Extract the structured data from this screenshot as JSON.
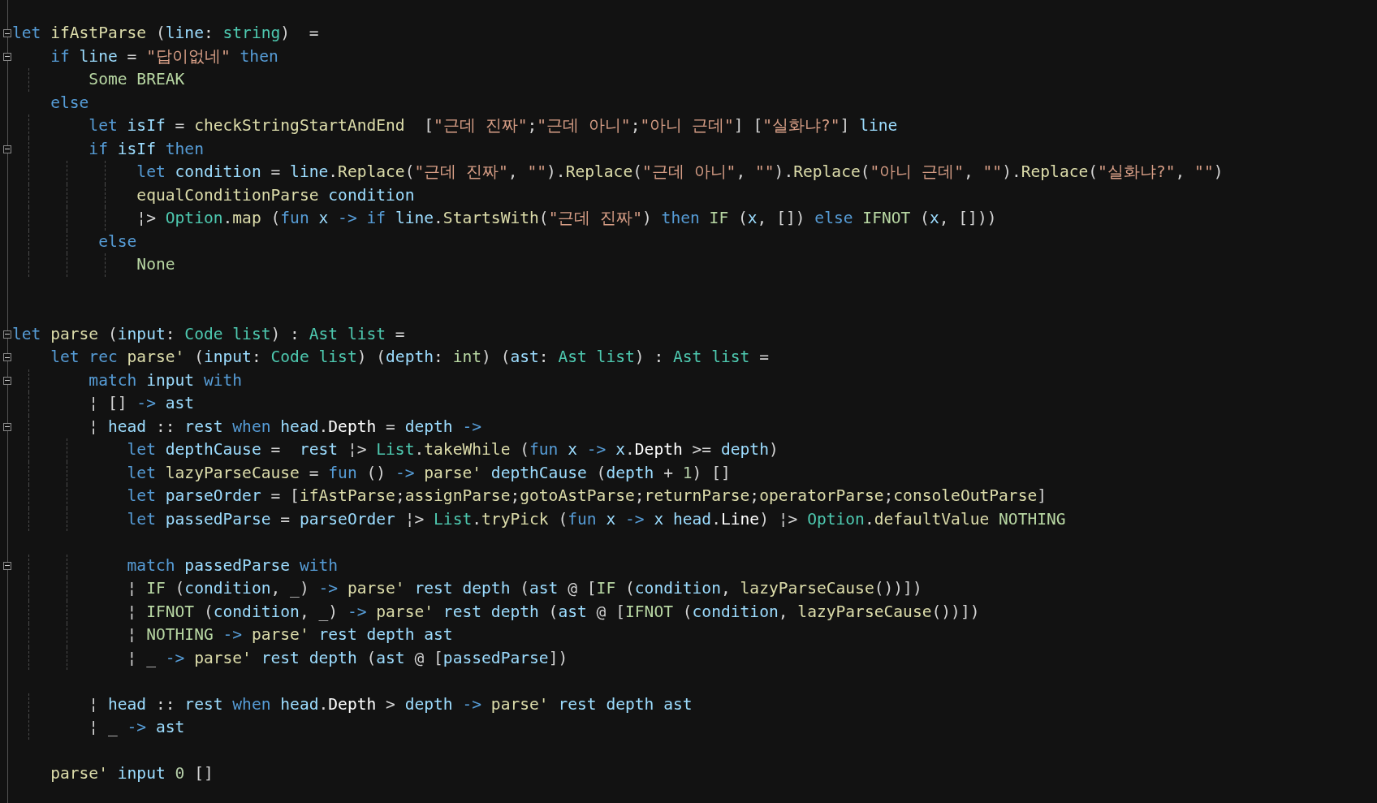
{
  "editor": {
    "lines": [
      {
        "kind": "code",
        "collapsible": true,
        "tokens": [
          {
            "kind": "keyword",
            "text": "let "
          },
          {
            "kind": "function",
            "text": "ifAstParse"
          },
          {
            "kind": "plain",
            "text": " ("
          },
          {
            "kind": "variable",
            "text": "line"
          },
          {
            "kind": "plain",
            "text": ": "
          },
          {
            "kind": "type",
            "text": "string"
          },
          {
            "kind": "plain",
            "text": ")  ="
          }
        ]
      },
      {
        "kind": "code",
        "collapsible": true,
        "tokens": [
          {
            "kind": "keyword",
            "text": "    if "
          },
          {
            "kind": "variable",
            "text": "line"
          },
          {
            "kind": "plain",
            "text": " = "
          },
          {
            "kind": "string",
            "text": "\"답이없네\""
          },
          {
            "kind": "keyword",
            "text": " then"
          }
        ]
      },
      {
        "kind": "code",
        "collapsible": false,
        "tokens": [
          {
            "kind": "case",
            "text": "        Some BREAK"
          }
        ]
      },
      {
        "kind": "code",
        "collapsible": false,
        "tokens": [
          {
            "kind": "keyword",
            "text": "    else"
          }
        ]
      },
      {
        "kind": "code",
        "collapsible": false,
        "tokens": [
          {
            "kind": "keyword",
            "text": "        let "
          },
          {
            "kind": "variable",
            "text": "isIf"
          },
          {
            "kind": "plain",
            "text": " = "
          },
          {
            "kind": "function",
            "text": "checkStringStartAndEnd"
          },
          {
            "kind": "plain",
            "text": "  ["
          },
          {
            "kind": "string",
            "text": "\"근데 진짜\""
          },
          {
            "kind": "plain",
            "text": ";"
          },
          {
            "kind": "string",
            "text": "\"근데 아니\""
          },
          {
            "kind": "plain",
            "text": ";"
          },
          {
            "kind": "string",
            "text": "\"아니 근데\""
          },
          {
            "kind": "plain",
            "text": "] ["
          },
          {
            "kind": "string",
            "text": "\"실화냐?\""
          },
          {
            "kind": "plain",
            "text": "] "
          },
          {
            "kind": "variable",
            "text": "line"
          }
        ]
      },
      {
        "kind": "code",
        "collapsible": true,
        "tokens": [
          {
            "kind": "keyword",
            "text": "        if "
          },
          {
            "kind": "variable",
            "text": "isIf"
          },
          {
            "kind": "keyword",
            "text": " then"
          }
        ]
      },
      {
        "kind": "code",
        "collapsible": false,
        "tokens": [
          {
            "kind": "keyword",
            "text": "             let "
          },
          {
            "kind": "variable",
            "text": "condition"
          },
          {
            "kind": "plain",
            "text": " = "
          },
          {
            "kind": "variable",
            "text": "line"
          },
          {
            "kind": "plain",
            "text": "."
          },
          {
            "kind": "function",
            "text": "Replace"
          },
          {
            "kind": "plain",
            "text": "("
          },
          {
            "kind": "string",
            "text": "\"근데 진짜\""
          },
          {
            "kind": "plain",
            "text": ", "
          },
          {
            "kind": "string",
            "text": "\"\""
          },
          {
            "kind": "plain",
            "text": ")."
          },
          {
            "kind": "function",
            "text": "Replace"
          },
          {
            "kind": "plain",
            "text": "("
          },
          {
            "kind": "string",
            "text": "\"근데 아니\""
          },
          {
            "kind": "plain",
            "text": ", "
          },
          {
            "kind": "string",
            "text": "\"\""
          },
          {
            "kind": "plain",
            "text": ")."
          },
          {
            "kind": "function",
            "text": "Replace"
          },
          {
            "kind": "plain",
            "text": "("
          },
          {
            "kind": "string",
            "text": "\"아니 근데\""
          },
          {
            "kind": "plain",
            "text": ", "
          },
          {
            "kind": "string",
            "text": "\"\""
          },
          {
            "kind": "plain",
            "text": ")."
          },
          {
            "kind": "function",
            "text": "Replace"
          },
          {
            "kind": "plain",
            "text": "("
          },
          {
            "kind": "string",
            "text": "\"실화냐?\""
          },
          {
            "kind": "plain",
            "text": ", "
          },
          {
            "kind": "string",
            "text": "\"\""
          },
          {
            "kind": "plain",
            "text": ")"
          }
        ]
      },
      {
        "kind": "code",
        "collapsible": false,
        "tokens": [
          {
            "kind": "function",
            "text": "             equalConditionParse "
          },
          {
            "kind": "variable",
            "text": "condition"
          }
        ]
      },
      {
        "kind": "code",
        "collapsible": false,
        "tokens": [
          {
            "kind": "plain",
            "text": "             ¦> "
          },
          {
            "kind": "type",
            "text": "Option"
          },
          {
            "kind": "plain",
            "text": "."
          },
          {
            "kind": "function",
            "text": "map"
          },
          {
            "kind": "plain",
            "text": " ("
          },
          {
            "kind": "keyword",
            "text": "fun "
          },
          {
            "kind": "variable",
            "text": "x"
          },
          {
            "kind": "keyword",
            "text": " -> if "
          },
          {
            "kind": "variable",
            "text": "line"
          },
          {
            "kind": "plain",
            "text": "."
          },
          {
            "kind": "function",
            "text": "StartsWith"
          },
          {
            "kind": "plain",
            "text": "("
          },
          {
            "kind": "string",
            "text": "\"근데 진짜\""
          },
          {
            "kind": "plain",
            "text": ") "
          },
          {
            "kind": "keyword",
            "text": "then "
          },
          {
            "kind": "case",
            "text": "IF"
          },
          {
            "kind": "plain",
            "text": " ("
          },
          {
            "kind": "variable",
            "text": "x"
          },
          {
            "kind": "plain",
            "text": ", []) "
          },
          {
            "kind": "keyword",
            "text": "else "
          },
          {
            "kind": "case",
            "text": "IFNOT"
          },
          {
            "kind": "plain",
            "text": " ("
          },
          {
            "kind": "variable",
            "text": "x"
          },
          {
            "kind": "plain",
            "text": ", []))"
          }
        ]
      },
      {
        "kind": "code",
        "collapsible": false,
        "tokens": [
          {
            "kind": "keyword",
            "text": "         else"
          }
        ]
      },
      {
        "kind": "code",
        "collapsible": false,
        "tokens": [
          {
            "kind": "case",
            "text": "             None"
          }
        ]
      },
      {
        "kind": "blank"
      },
      {
        "kind": "blank"
      },
      {
        "kind": "code",
        "collapsible": true,
        "tokens": [
          {
            "kind": "keyword",
            "text": "let "
          },
          {
            "kind": "function",
            "text": "parse"
          },
          {
            "kind": "plain",
            "text": " ("
          },
          {
            "kind": "variable",
            "text": "input"
          },
          {
            "kind": "plain",
            "text": ": "
          },
          {
            "kind": "type",
            "text": "Code list"
          },
          {
            "kind": "plain",
            "text": ") : "
          },
          {
            "kind": "type",
            "text": "Ast list"
          },
          {
            "kind": "plain",
            "text": " ="
          }
        ]
      },
      {
        "kind": "code",
        "collapsible": true,
        "tokens": [
          {
            "kind": "keyword",
            "text": "    let rec "
          },
          {
            "kind": "function",
            "text": "parse'"
          },
          {
            "kind": "plain",
            "text": " ("
          },
          {
            "kind": "variable",
            "text": "input"
          },
          {
            "kind": "plain",
            "text": ": "
          },
          {
            "kind": "type",
            "text": "Code list"
          },
          {
            "kind": "plain",
            "text": ") ("
          },
          {
            "kind": "variable",
            "text": "depth"
          },
          {
            "kind": "plain",
            "text": ": "
          },
          {
            "kind": "case",
            "text": "int"
          },
          {
            "kind": "plain",
            "text": ") ("
          },
          {
            "kind": "variable",
            "text": "ast"
          },
          {
            "kind": "plain",
            "text": ": "
          },
          {
            "kind": "type",
            "text": "Ast list"
          },
          {
            "kind": "plain",
            "text": ") : "
          },
          {
            "kind": "type",
            "text": "Ast list"
          },
          {
            "kind": "plain",
            "text": " ="
          }
        ]
      },
      {
        "kind": "code",
        "collapsible": true,
        "tokens": [
          {
            "kind": "keyword",
            "text": "        match "
          },
          {
            "kind": "variable",
            "text": "input"
          },
          {
            "kind": "keyword",
            "text": " with"
          }
        ]
      },
      {
        "kind": "code",
        "collapsible": false,
        "tokens": [
          {
            "kind": "plain",
            "text": "        ¦ [] "
          },
          {
            "kind": "keyword",
            "text": "->"
          },
          {
            "kind": "variable",
            "text": " ast"
          }
        ]
      },
      {
        "kind": "code",
        "collapsible": true,
        "tokens": [
          {
            "kind": "plain",
            "text": "        ¦ "
          },
          {
            "kind": "variable",
            "text": "head"
          },
          {
            "kind": "plain",
            "text": " :: "
          },
          {
            "kind": "variable",
            "text": "rest"
          },
          {
            "kind": "keyword",
            "text": " when "
          },
          {
            "kind": "variable",
            "text": "head"
          },
          {
            "kind": "plain",
            "text": "."
          },
          {
            "kind": "member",
            "text": "Depth"
          },
          {
            "kind": "plain",
            "text": " = "
          },
          {
            "kind": "variable",
            "text": "depth"
          },
          {
            "kind": "keyword",
            "text": " ->"
          }
        ]
      },
      {
        "kind": "code",
        "collapsible": false,
        "tokens": [
          {
            "kind": "keyword",
            "text": "            let "
          },
          {
            "kind": "variable",
            "text": "depthCause"
          },
          {
            "kind": "plain",
            "text": " =  "
          },
          {
            "kind": "variable",
            "text": "rest"
          },
          {
            "kind": "plain",
            "text": " ¦> "
          },
          {
            "kind": "type",
            "text": "List"
          },
          {
            "kind": "plain",
            "text": "."
          },
          {
            "kind": "function",
            "text": "takeWhile"
          },
          {
            "kind": "plain",
            "text": " ("
          },
          {
            "kind": "keyword",
            "text": "fun "
          },
          {
            "kind": "variable",
            "text": "x"
          },
          {
            "kind": "keyword",
            "text": " -> "
          },
          {
            "kind": "variable",
            "text": "x"
          },
          {
            "kind": "plain",
            "text": "."
          },
          {
            "kind": "member",
            "text": "Depth"
          },
          {
            "kind": "plain",
            "text": " >= "
          },
          {
            "kind": "variable",
            "text": "depth"
          },
          {
            "kind": "plain",
            "text": ")"
          }
        ]
      },
      {
        "kind": "code",
        "collapsible": false,
        "tokens": [
          {
            "kind": "keyword",
            "text": "            let "
          },
          {
            "kind": "function",
            "text": "lazyParseCause"
          },
          {
            "kind": "plain",
            "text": " = "
          },
          {
            "kind": "keyword",
            "text": "fun "
          },
          {
            "kind": "plain",
            "text": "() "
          },
          {
            "kind": "keyword",
            "text": "-> "
          },
          {
            "kind": "function",
            "text": "parse'"
          },
          {
            "kind": "variable",
            "text": " depthCause"
          },
          {
            "kind": "plain",
            "text": " ("
          },
          {
            "kind": "variable",
            "text": "depth"
          },
          {
            "kind": "plain",
            "text": " + "
          },
          {
            "kind": "number",
            "text": "1"
          },
          {
            "kind": "plain",
            "text": ") []"
          }
        ]
      },
      {
        "kind": "code",
        "collapsible": false,
        "tokens": [
          {
            "kind": "keyword",
            "text": "            let "
          },
          {
            "kind": "variable",
            "text": "parseOrder"
          },
          {
            "kind": "plain",
            "text": " = ["
          },
          {
            "kind": "function",
            "text": "ifAstParse"
          },
          {
            "kind": "plain",
            "text": ";"
          },
          {
            "kind": "function",
            "text": "assignParse"
          },
          {
            "kind": "plain",
            "text": ";"
          },
          {
            "kind": "function",
            "text": "gotoAstParse"
          },
          {
            "kind": "plain",
            "text": ";"
          },
          {
            "kind": "function",
            "text": "returnParse"
          },
          {
            "kind": "plain",
            "text": ";"
          },
          {
            "kind": "function",
            "text": "operatorParse"
          },
          {
            "kind": "plain",
            "text": ";"
          },
          {
            "kind": "function",
            "text": "consoleOutParse"
          },
          {
            "kind": "plain",
            "text": "]"
          }
        ]
      },
      {
        "kind": "code",
        "collapsible": false,
        "tokens": [
          {
            "kind": "keyword",
            "text": "            let "
          },
          {
            "kind": "variable",
            "text": "passedParse"
          },
          {
            "kind": "plain",
            "text": " = "
          },
          {
            "kind": "variable",
            "text": "parseOrder"
          },
          {
            "kind": "plain",
            "text": " ¦> "
          },
          {
            "kind": "type",
            "text": "List"
          },
          {
            "kind": "plain",
            "text": "."
          },
          {
            "kind": "function",
            "text": "tryPick"
          },
          {
            "kind": "plain",
            "text": " ("
          },
          {
            "kind": "keyword",
            "text": "fun "
          },
          {
            "kind": "variable",
            "text": "x"
          },
          {
            "kind": "keyword",
            "text": " -> "
          },
          {
            "kind": "variable",
            "text": "x head"
          },
          {
            "kind": "plain",
            "text": "."
          },
          {
            "kind": "member",
            "text": "Line"
          },
          {
            "kind": "plain",
            "text": ") ¦> "
          },
          {
            "kind": "type",
            "text": "Option"
          },
          {
            "kind": "plain",
            "text": "."
          },
          {
            "kind": "function",
            "text": "defaultValue "
          },
          {
            "kind": "case",
            "text": "NOTHING"
          }
        ]
      },
      {
        "kind": "blank"
      },
      {
        "kind": "code",
        "collapsible": true,
        "tokens": [
          {
            "kind": "keyword",
            "text": "            match "
          },
          {
            "kind": "variable",
            "text": "passedParse"
          },
          {
            "kind": "keyword",
            "text": " with"
          }
        ]
      },
      {
        "kind": "code",
        "collapsible": false,
        "tokens": [
          {
            "kind": "plain",
            "text": "            ¦ "
          },
          {
            "kind": "case",
            "text": "IF"
          },
          {
            "kind": "plain",
            "text": " ("
          },
          {
            "kind": "variable",
            "text": "condition"
          },
          {
            "kind": "plain",
            "text": ", _) "
          },
          {
            "kind": "keyword",
            "text": "-> "
          },
          {
            "kind": "function",
            "text": "parse'"
          },
          {
            "kind": "variable",
            "text": " rest depth"
          },
          {
            "kind": "plain",
            "text": " ("
          },
          {
            "kind": "variable",
            "text": "ast"
          },
          {
            "kind": "plain",
            "text": " @ ["
          },
          {
            "kind": "case",
            "text": "IF"
          },
          {
            "kind": "plain",
            "text": " ("
          },
          {
            "kind": "variable",
            "text": "condition"
          },
          {
            "kind": "plain",
            "text": ", "
          },
          {
            "kind": "function",
            "text": "lazyParseCause"
          },
          {
            "kind": "plain",
            "text": "())])"
          }
        ]
      },
      {
        "kind": "code",
        "collapsible": false,
        "tokens": [
          {
            "kind": "plain",
            "text": "            ¦ "
          },
          {
            "kind": "case",
            "text": "IFNOT"
          },
          {
            "kind": "plain",
            "text": " ("
          },
          {
            "kind": "variable",
            "text": "condition"
          },
          {
            "kind": "plain",
            "text": ", _) "
          },
          {
            "kind": "keyword",
            "text": "-> "
          },
          {
            "kind": "function",
            "text": "parse'"
          },
          {
            "kind": "variable",
            "text": " rest depth"
          },
          {
            "kind": "plain",
            "text": " ("
          },
          {
            "kind": "variable",
            "text": "ast"
          },
          {
            "kind": "plain",
            "text": " @ ["
          },
          {
            "kind": "case",
            "text": "IFNOT"
          },
          {
            "kind": "plain",
            "text": " ("
          },
          {
            "kind": "variable",
            "text": "condition"
          },
          {
            "kind": "plain",
            "text": ", "
          },
          {
            "kind": "function",
            "text": "lazyParseCause"
          },
          {
            "kind": "plain",
            "text": "())])"
          }
        ]
      },
      {
        "kind": "code",
        "collapsible": false,
        "tokens": [
          {
            "kind": "plain",
            "text": "            ¦ "
          },
          {
            "kind": "case",
            "text": "NOTHING"
          },
          {
            "kind": "keyword",
            "text": " -> "
          },
          {
            "kind": "function",
            "text": "parse'"
          },
          {
            "kind": "variable",
            "text": " rest depth ast"
          }
        ]
      },
      {
        "kind": "code",
        "collapsible": false,
        "tokens": [
          {
            "kind": "plain",
            "text": "            ¦ _ "
          },
          {
            "kind": "keyword",
            "text": "-> "
          },
          {
            "kind": "function",
            "text": "parse'"
          },
          {
            "kind": "variable",
            "text": " rest depth"
          },
          {
            "kind": "plain",
            "text": " ("
          },
          {
            "kind": "variable",
            "text": "ast"
          },
          {
            "kind": "plain",
            "text": " @ ["
          },
          {
            "kind": "variable",
            "text": "passedParse"
          },
          {
            "kind": "plain",
            "text": "])"
          }
        ]
      },
      {
        "kind": "blank"
      },
      {
        "kind": "code",
        "collapsible": false,
        "tokens": [
          {
            "kind": "plain",
            "text": "        ¦ "
          },
          {
            "kind": "variable",
            "text": "head"
          },
          {
            "kind": "plain",
            "text": " :: "
          },
          {
            "kind": "variable",
            "text": "rest"
          },
          {
            "kind": "keyword",
            "text": " when "
          },
          {
            "kind": "variable",
            "text": "head"
          },
          {
            "kind": "plain",
            "text": "."
          },
          {
            "kind": "member",
            "text": "Depth"
          },
          {
            "kind": "plain",
            "text": " > "
          },
          {
            "kind": "variable",
            "text": "depth"
          },
          {
            "kind": "keyword",
            "text": " -> "
          },
          {
            "kind": "function",
            "text": "parse'"
          },
          {
            "kind": "variable",
            "text": " rest depth ast"
          }
        ]
      },
      {
        "kind": "code",
        "collapsible": false,
        "tokens": [
          {
            "kind": "plain",
            "text": "        ¦ _ "
          },
          {
            "kind": "keyword",
            "text": "-> "
          },
          {
            "kind": "variable",
            "text": "ast"
          }
        ]
      },
      {
        "kind": "blank"
      },
      {
        "kind": "code",
        "collapsible": false,
        "tokens": [
          {
            "kind": "function",
            "text": "    parse'"
          },
          {
            "kind": "variable",
            "text": " input "
          },
          {
            "kind": "number",
            "text": "0"
          },
          {
            "kind": "plain",
            "text": " []"
          }
        ]
      }
    ]
  }
}
